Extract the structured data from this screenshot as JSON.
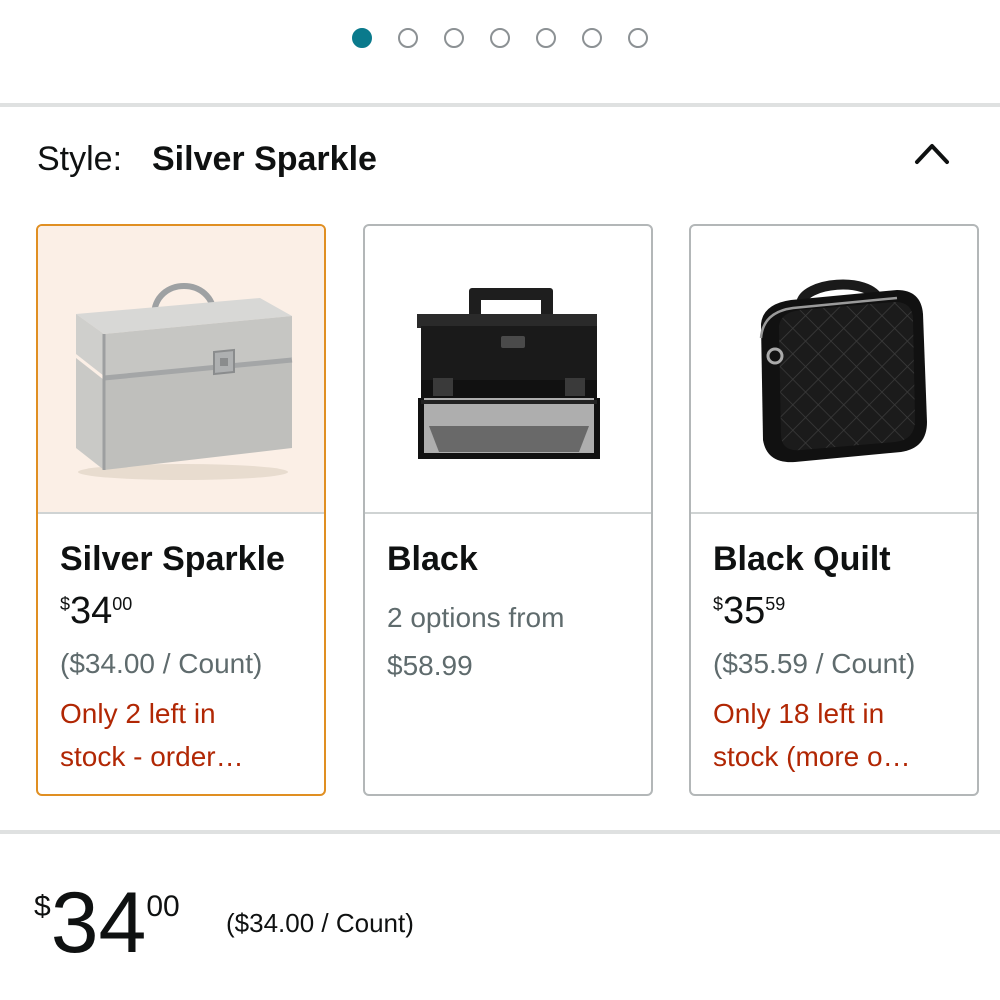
{
  "carousel": {
    "dot_count": 7,
    "active_index": 0
  },
  "style_selector": {
    "label": "Style:",
    "selected": "Silver Sparkle",
    "collapse_icon": "chevron-up-icon"
  },
  "options": [
    {
      "name": "Silver Sparkle",
      "price": {
        "symbol": "$",
        "whole": "34",
        "fraction": "00"
      },
      "unit_price": "($34.00 / Count)",
      "stock_lines": [
        "Only 2 left in",
        "stock - order…"
      ],
      "selected": true,
      "image_icon": "silver-sparkle-case-image"
    },
    {
      "name": "Black",
      "options_lines": [
        "2 options from",
        "$58.99"
      ],
      "selected": false,
      "image_icon": "black-aluminum-case-image"
    },
    {
      "name": "Black Quilt",
      "price": {
        "symbol": "$",
        "whole": "35",
        "fraction": "59"
      },
      "unit_price": "($35.59 / Count)",
      "stock_lines": [
        "Only 18 left in",
        "stock (more o…"
      ],
      "selected": false,
      "image_icon": "black-quilt-bag-image"
    }
  ],
  "main_price": {
    "symbol": "$",
    "whole": "34",
    "fraction": "00",
    "unit_price": "($34.00 / Count)"
  },
  "colors": {
    "accent_teal": "#0a7a8c",
    "selected_border": "#e08f22",
    "stock_red": "#b12704",
    "secondary_text": "#5f6b6d"
  }
}
